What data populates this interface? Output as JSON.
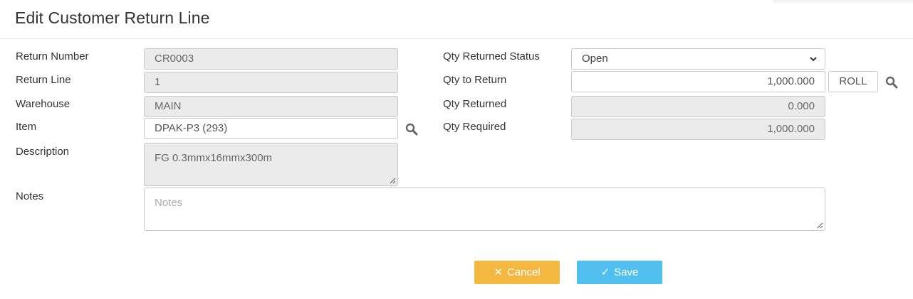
{
  "page": {
    "title": "Edit Customer Return Line"
  },
  "left": {
    "return_number": {
      "label": "Return Number",
      "value": "CR0003"
    },
    "return_line": {
      "label": "Return Line",
      "value": "1"
    },
    "warehouse": {
      "label": "Warehouse",
      "value": "MAIN"
    },
    "item": {
      "label": "Item",
      "value": "DPAK-P3 (293)"
    },
    "description": {
      "label": "Description",
      "value": "FG 0.3mmx16mmx300m"
    },
    "notes": {
      "label": "Notes",
      "placeholder": "Notes"
    }
  },
  "right": {
    "qty_returned_status": {
      "label": "Qty Returned Status",
      "value": "Open"
    },
    "qty_to_return": {
      "label": "Qty to Return",
      "value": "1,000.000",
      "unit": "ROLL"
    },
    "qty_returned": {
      "label": "Qty Returned",
      "value": "0.000"
    },
    "qty_required": {
      "label": "Qty Required",
      "value": "1,000.000"
    }
  },
  "buttons": {
    "cancel": "Cancel",
    "save": "Save",
    "cancel_icon": "✕",
    "save_icon": "✓"
  },
  "colors": {
    "cancel": "#f4b840",
    "save": "#51c0f0",
    "readonly_bg": "#ebebeb"
  },
  "icons": {
    "lookup": "search-icon",
    "dropdown": "chevron-down-icon"
  }
}
